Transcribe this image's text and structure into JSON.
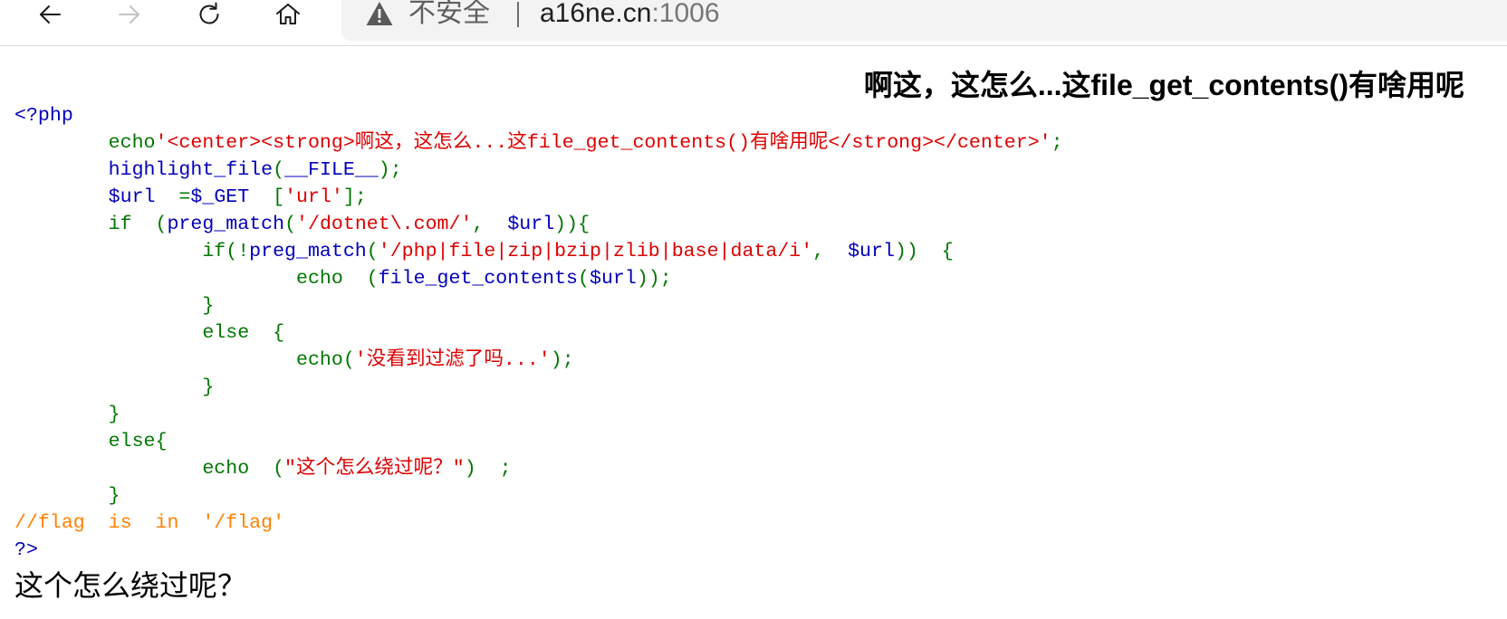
{
  "browser": {
    "toolbar": {
      "back": {
        "icon": "back-arrow-icon"
      },
      "forward": {
        "icon": "forward-arrow-icon",
        "disabled": true
      },
      "reload": {
        "icon": "reload-icon"
      },
      "home": {
        "icon": "home-icon"
      }
    },
    "address_bar": {
      "security_icon": "warning-icon",
      "security_label": "不安全",
      "host": "a16ne.cn",
      "port": ":1006"
    }
  },
  "page": {
    "heading": "啊这，这怎么...这file_get_contents()有啥用呢",
    "output": "这个怎么绕过呢？"
  },
  "code": {
    "colors": {
      "default": "#0000BB",
      "keyword": "#007700",
      "string": "#DD0000",
      "comment": "#FF8000"
    },
    "lines": [
      [
        {
          "c": "default",
          "t": "<?php"
        }
      ],
      [
        {
          "c": "keyword",
          "t": "        echo"
        },
        {
          "c": "string",
          "t": "'<center><strong>啊这，这怎么...这file_get_contents()有啥用呢</strong></center>'"
        },
        {
          "c": "keyword",
          "t": ";"
        }
      ],
      [
        {
          "c": "default",
          "t": "        highlight_file"
        },
        {
          "c": "keyword",
          "t": "("
        },
        {
          "c": "default",
          "t": "__FILE__"
        },
        {
          "c": "keyword",
          "t": ");"
        }
      ],
      [
        {
          "c": "default",
          "t": "        $url"
        },
        {
          "c": "keyword",
          "t": "  ="
        },
        {
          "c": "default",
          "t": "$_GET"
        },
        {
          "c": "keyword",
          "t": "  ["
        },
        {
          "c": "string",
          "t": "'url'"
        },
        {
          "c": "keyword",
          "t": "];"
        }
      ],
      [
        {
          "c": "keyword",
          "t": "        if  ("
        },
        {
          "c": "default",
          "t": "preg_match"
        },
        {
          "c": "keyword",
          "t": "("
        },
        {
          "c": "string",
          "t": "'/dotnet\\.com/'"
        },
        {
          "c": "keyword",
          "t": ",  "
        },
        {
          "c": "default",
          "t": "$url"
        },
        {
          "c": "keyword",
          "t": ")){"
        }
      ],
      [
        {
          "c": "keyword",
          "t": "                if(!"
        },
        {
          "c": "default",
          "t": "preg_match"
        },
        {
          "c": "keyword",
          "t": "("
        },
        {
          "c": "string",
          "t": "'/php|file|zip|bzip|zlib|base|data/i'"
        },
        {
          "c": "keyword",
          "t": ",  "
        },
        {
          "c": "default",
          "t": "$url"
        },
        {
          "c": "keyword",
          "t": "))  {"
        }
      ],
      [
        {
          "c": "keyword",
          "t": "                        echo  ("
        },
        {
          "c": "default",
          "t": "file_get_contents"
        },
        {
          "c": "keyword",
          "t": "("
        },
        {
          "c": "default",
          "t": "$url"
        },
        {
          "c": "keyword",
          "t": "));"
        }
      ],
      [
        {
          "c": "keyword",
          "t": "                }"
        }
      ],
      [
        {
          "c": "keyword",
          "t": "                else  {"
        }
      ],
      [
        {
          "c": "keyword",
          "t": "                        echo("
        },
        {
          "c": "string",
          "t": "'没看到过滤了吗...'"
        },
        {
          "c": "keyword",
          "t": ");"
        }
      ],
      [
        {
          "c": "keyword",
          "t": "                }"
        }
      ],
      [
        {
          "c": "keyword",
          "t": "        }"
        }
      ],
      [
        {
          "c": "keyword",
          "t": "        else{"
        }
      ],
      [
        {
          "c": "keyword",
          "t": "                echo  ("
        },
        {
          "c": "string",
          "t": "\"这个怎么绕过呢？\""
        },
        {
          "c": "keyword",
          "t": ")  ;"
        }
      ],
      [
        {
          "c": "keyword",
          "t": "        }"
        }
      ],
      [
        {
          "c": "comment",
          "t": "//flag  is  in  '/flag'"
        }
      ],
      [
        {
          "c": "default",
          "t": "?>"
        }
      ]
    ]
  }
}
